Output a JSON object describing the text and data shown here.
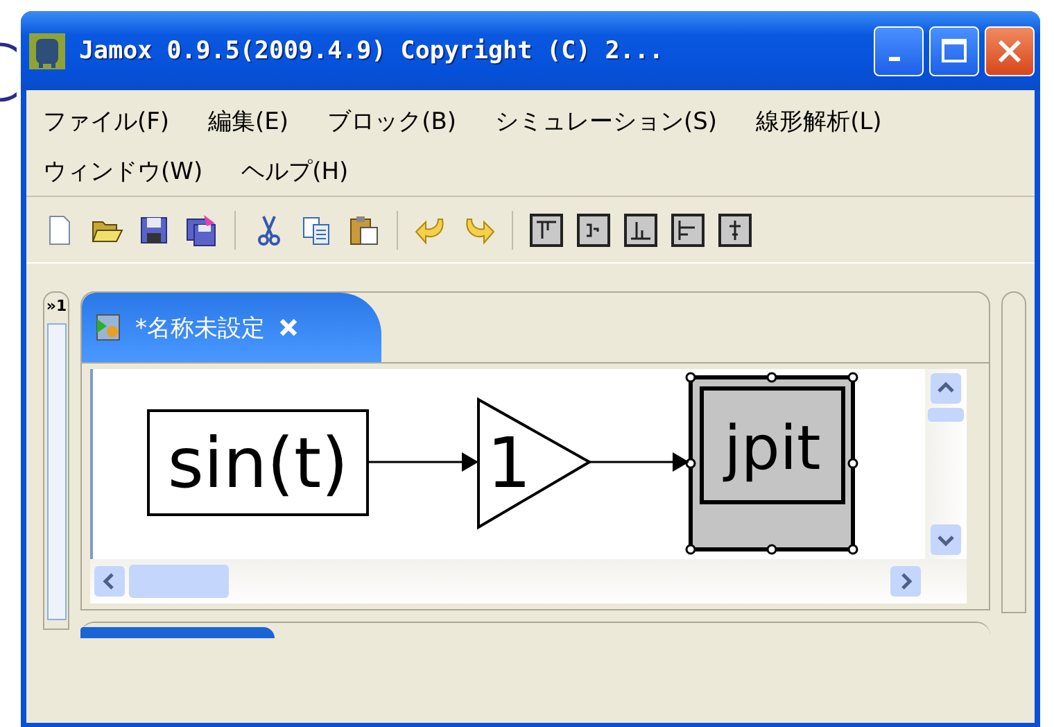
{
  "window": {
    "title": "Jamox 0.9.5(2009.4.9) Copyright (C) 2..."
  },
  "menu_rows": [
    [
      "ファイル(F)",
      "編集(E)",
      "ブロック(B)",
      "シミュレーション(S)",
      "線形解析(L)"
    ],
    [
      "ウィンドウ(W)",
      "ヘルプ(H)"
    ]
  ],
  "toolbar": [
    {
      "kind": "new"
    },
    {
      "kind": "open"
    },
    {
      "kind": "save"
    },
    {
      "kind": "save-all"
    },
    {
      "kind": "separator"
    },
    {
      "kind": "cut"
    },
    {
      "kind": "copy"
    },
    {
      "kind": "paste"
    },
    {
      "kind": "separator"
    },
    {
      "kind": "undo"
    },
    {
      "kind": "redo"
    },
    {
      "kind": "separator"
    },
    {
      "kind": "align-top"
    },
    {
      "kind": "align-middle"
    },
    {
      "kind": "align-bottom"
    },
    {
      "kind": "align-left"
    },
    {
      "kind": "align-center"
    }
  ],
  "side_panel": {
    "chevron": "»",
    "count": "1"
  },
  "editor_tabs": [
    {
      "label": "*名称未設定",
      "selected": true
    }
  ],
  "blocks": [
    {
      "kind": "source",
      "label": "sin(t)",
      "selected": false
    },
    {
      "kind": "gain",
      "label": "1",
      "selected": false
    },
    {
      "kind": "subsystem",
      "label": "jpit",
      "selected": true
    }
  ]
}
